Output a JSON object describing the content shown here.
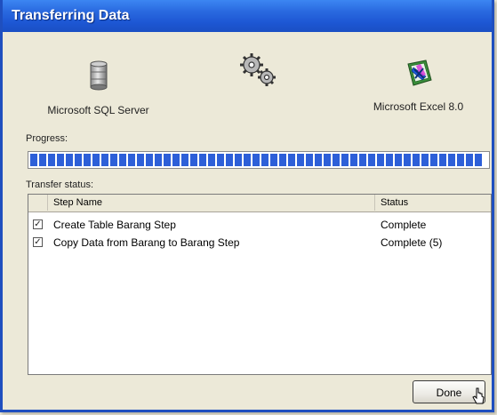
{
  "window": {
    "title": "Transferring Data"
  },
  "source": {
    "label": "Microsoft SQL Server",
    "icon": "database-icon"
  },
  "process": {
    "icon": "gears-icon"
  },
  "destination": {
    "label": "Microsoft Excel 8.0",
    "icon": "excel-icon"
  },
  "progress": {
    "label": "Progress:",
    "value": 1.0
  },
  "transfer": {
    "label": "Transfer status:",
    "columns": [
      "Step Name",
      "Status"
    ],
    "rows": [
      {
        "checked": true,
        "step": "Create Table Barang Step",
        "status": "Complete"
      },
      {
        "checked": true,
        "step": "Copy Data from Barang to Barang Step",
        "status": "Complete (5)"
      }
    ]
  },
  "buttons": {
    "done": "Done"
  },
  "colors": {
    "titlebar": "#1d57d4",
    "progress_block": "#2d5fd8"
  }
}
